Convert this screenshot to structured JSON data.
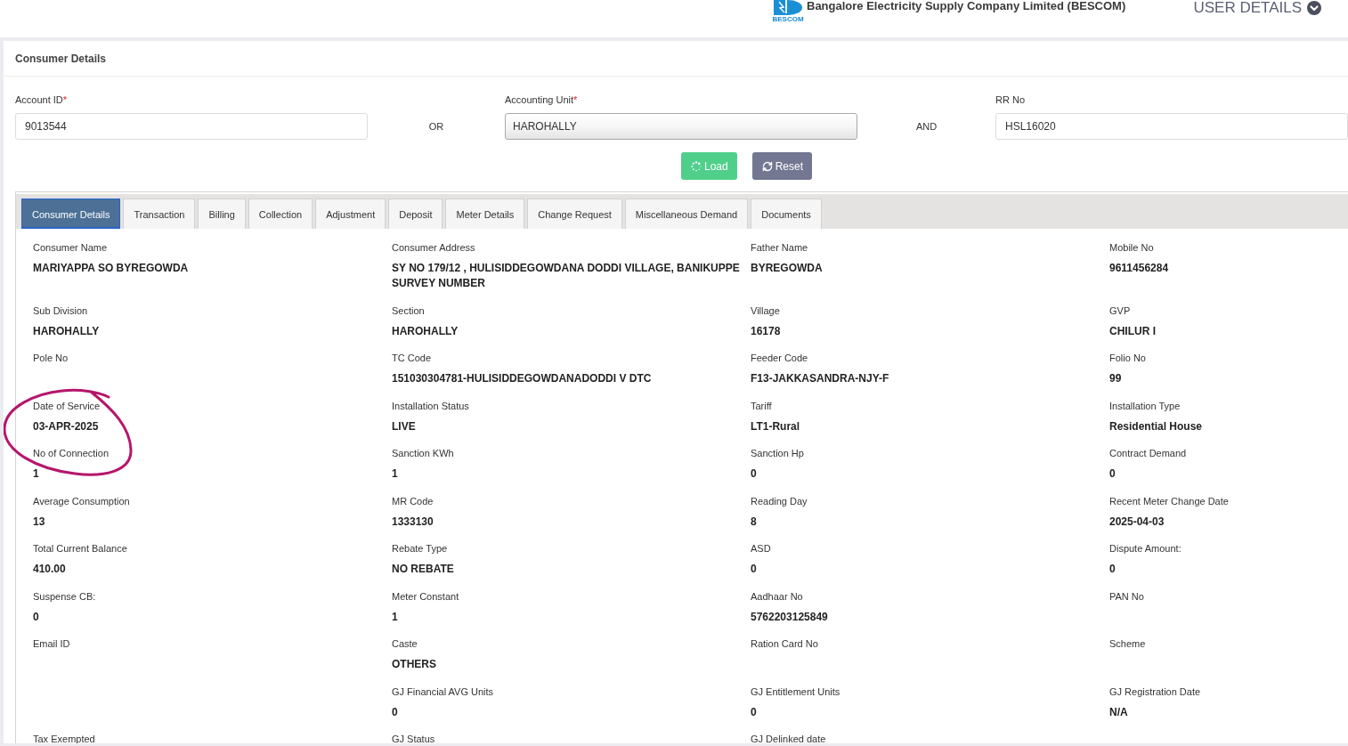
{
  "header": {
    "logo_caption": "BESCOM",
    "title": "Bangalore Electricity Supply Company Limited (BESCOM)",
    "user_menu": "USER DETAILS"
  },
  "section_title": "Consumer Details",
  "search_form": {
    "fields": [
      {
        "kind": "input",
        "label": "Account ID",
        "required_mark": "*",
        "value": "9013544"
      },
      {
        "kind": "select",
        "label": "Accounting Unit",
        "required_mark": "*",
        "value": "HAROHALLY"
      },
      {
        "kind": "input",
        "label": "RR No",
        "value": "HSL16020"
      }
    ],
    "connectors": [
      "OR",
      "AND"
    ],
    "buttons": [
      {
        "kind": "load",
        "label": "Load"
      },
      {
        "kind": "reset",
        "label": "Reset"
      }
    ]
  },
  "tabs": [
    {
      "label": "Consumer Details",
      "selected": true
    },
    {
      "label": "Transaction",
      "selected": false
    },
    {
      "label": "Billing",
      "selected": false
    },
    {
      "label": "Collection",
      "selected": false
    },
    {
      "label": "Adjustment",
      "selected": false
    },
    {
      "label": "Deposit",
      "selected": false
    },
    {
      "label": "Meter Details",
      "selected": false
    },
    {
      "label": "Change Request",
      "selected": false
    },
    {
      "label": "Miscellaneous Demand",
      "selected": false
    },
    {
      "label": "Documents",
      "selected": false
    }
  ],
  "details": {
    "rows": [
      {
        "cells": [
          {
            "label": "Consumer Name",
            "value": "MARIYAPPA SO BYREGOWDA",
            "circled": false
          },
          {
            "label": "Consumer Address",
            "value": "SY NO 179/12 , HULISIDDEGOWDANA DODDI VILLAGE, BANIKUPPE SURVEY NUMBER",
            "circled": false
          },
          {
            "label": "Father Name",
            "value": "BYREGOWDA",
            "circled": false
          },
          {
            "label": "Mobile No",
            "value": "9611456284",
            "circled": false
          }
        ]
      },
      {
        "cells": [
          {
            "label": "Sub Division",
            "value": "HAROHALLY",
            "circled": false
          },
          {
            "label": "Section",
            "value": "HAROHALLY",
            "circled": false
          },
          {
            "label": "Village",
            "value": "16178",
            "circled": false
          },
          {
            "label": "GVP",
            "value": "CHILUR I",
            "circled": false
          }
        ]
      },
      {
        "cells": [
          {
            "label": "Pole No",
            "circled": false
          },
          {
            "label": "TC Code",
            "value": "151030304781-HULISIDDEGOWDANADODDI V DTC",
            "circled": false
          },
          {
            "label": "Feeder Code",
            "value": "F13-JAKKASANDRA-NJY-F",
            "circled": false
          },
          {
            "label": "Folio No",
            "value": "99",
            "circled": false
          }
        ]
      },
      {
        "cells": [
          {
            "label": "Date of Service",
            "value": "03-APR-2025",
            "circled": true
          },
          {
            "label": "Installation Status",
            "value": "LIVE",
            "circled": false
          },
          {
            "label": "Tariff",
            "value": "LT1-Rural",
            "circled": false
          },
          {
            "label": "Installation Type",
            "value": "Residential House",
            "circled": false
          }
        ]
      },
      {
        "cells": [
          {
            "label": "No of Connection",
            "value": "1",
            "circled": false
          },
          {
            "label": "Sanction KWh",
            "value": "1",
            "circled": false
          },
          {
            "label": "Sanction Hp",
            "value": "0",
            "circled": false
          },
          {
            "label": "Contract Demand",
            "value": "0",
            "circled": false
          }
        ]
      },
      {
        "cells": [
          {
            "label": "Average Consumption",
            "value": "13",
            "circled": false
          },
          {
            "label": "MR Code",
            "value": "1333130",
            "circled": false
          },
          {
            "label": "Reading Day",
            "value": "8",
            "circled": false
          },
          {
            "label": "Recent Meter Change Date",
            "value": "2025-04-03",
            "circled": false
          }
        ]
      },
      {
        "cells": [
          {
            "label": "Total Current Balance",
            "value": "410.00",
            "circled": false
          },
          {
            "label": "Rebate Type",
            "value": "NO REBATE",
            "circled": false
          },
          {
            "label": "ASD",
            "value": "0",
            "circled": false
          },
          {
            "label": "Dispute Amount:",
            "value": "0",
            "circled": false
          }
        ]
      },
      {
        "cells": [
          {
            "label": "Suspense CB:",
            "value": "0",
            "circled": false
          },
          {
            "label": "Meter Constant",
            "value": "1",
            "circled": false
          },
          {
            "label": "Aadhaar No",
            "value": "5762203125849",
            "circled": false
          },
          {
            "label": "PAN No",
            "circled": false
          }
        ]
      },
      {
        "cells": [
          {
            "label": "Email ID",
            "circled": false
          },
          {
            "label": "Caste",
            "value": "OTHERS",
            "circled": false
          },
          {
            "label": "Ration Card No",
            "circled": false
          },
          {
            "label": "Scheme",
            "circled": false
          }
        ]
      },
      {
        "cells": [
          null,
          {
            "label": "GJ Financial AVG Units",
            "value": "0",
            "circled": false
          },
          {
            "label": "GJ Entitlement Units",
            "value": "0",
            "circled": false
          },
          {
            "label": "GJ Registration Date",
            "value": "N/A",
            "circled": false
          }
        ]
      },
      {
        "cells": [
          {
            "label": "Tax Exempted",
            "circled": false
          },
          {
            "label": "GJ Status",
            "circled": false
          },
          {
            "label": "GJ Delinked date",
            "circled": false
          }
        ]
      }
    ]
  }
}
